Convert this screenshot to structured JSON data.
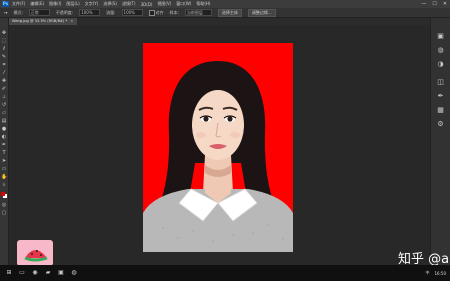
{
  "menubar": {
    "items": [
      "文件(F)",
      "编辑(E)",
      "图像(I)",
      "图层(L)",
      "文字(Y)",
      "选择(S)",
      "滤镜(T)",
      "3D(D)",
      "视图(V)",
      "窗口(W)",
      "帮助(H)"
    ],
    "window_controls": [
      "—",
      "☐",
      "✕"
    ]
  },
  "options": {
    "mode_label": "模式:",
    "mode_value": "正常",
    "opacity_label": "不透明度:",
    "opacity_value": "100%",
    "flow_label": "流量:",
    "flow_value": "100%",
    "align_label": "对齐",
    "sample_label": "样本:",
    "sample_value": "当前图层",
    "btn1": "选择主体",
    "btn2": "调整边缘..."
  },
  "document": {
    "tab_title": "Wang.jpg @ 33.3% (RGB/8#) *",
    "close": "×"
  },
  "colors": {
    "photo_background": "#ff0000",
    "foreground_swatch": "#e00000",
    "background_swatch": "#ffffff"
  },
  "icons": {
    "toolbar": [
      "move",
      "marquee",
      "lasso",
      "quick-select",
      "crop",
      "eyedropper",
      "healing",
      "brush",
      "stamp",
      "history",
      "eraser",
      "gradient",
      "blur",
      "dodge",
      "pen",
      "type",
      "path-select",
      "shape",
      "hand",
      "zoom"
    ],
    "right": [
      "history-panel",
      "color-panel",
      "adjust-panel",
      "layers-panel",
      "paths-panel",
      "channels-panel",
      "properties-panel"
    ]
  },
  "watermark": "知乎 @a",
  "taskbar": {
    "time": "16:50",
    "lang": "中"
  }
}
